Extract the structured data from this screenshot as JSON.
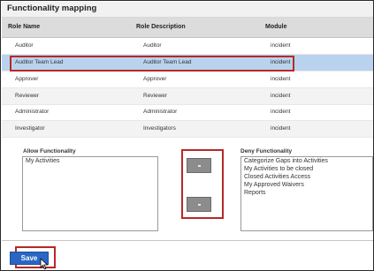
{
  "title": "Functionality mapping",
  "table": {
    "columns": [
      "Role Name",
      "Role Description",
      "Module"
    ],
    "rows": [
      {
        "name": "Auditor",
        "description": "Auditor",
        "module": "incident"
      },
      {
        "name": "Auditor Team Lead",
        "description": "Auditor Team Lead",
        "module": "incident"
      },
      {
        "name": "Approver",
        "description": "Approver",
        "module": "incident"
      },
      {
        "name": "Reviewer",
        "description": "Reviewer",
        "module": "incident"
      },
      {
        "name": "Administrator",
        "description": "Administrator",
        "module": "incident"
      },
      {
        "name": "Investigator",
        "description": "Investigators",
        "module": "incident"
      }
    ],
    "selected_row": "Auditor Team Lead"
  },
  "allow": {
    "label": "Allow Functionality",
    "items": [
      "My Activities"
    ]
  },
  "deny": {
    "label": "Deny Functionality",
    "items": [
      "Categorize Gaps into Activities",
      "My Activities to be closed",
      "Closed Activities Access",
      "My Approved Waivers",
      "Reports"
    ]
  },
  "buttons": {
    "save": "Save",
    "move_to_deny_icon": "arrow-right-icon",
    "move_to_allow_icon": "arrow-left-icon"
  },
  "colors": {
    "selected_row": "#b9d3ee",
    "highlight_box": "#b72828",
    "save_button": "#2a67c4"
  }
}
